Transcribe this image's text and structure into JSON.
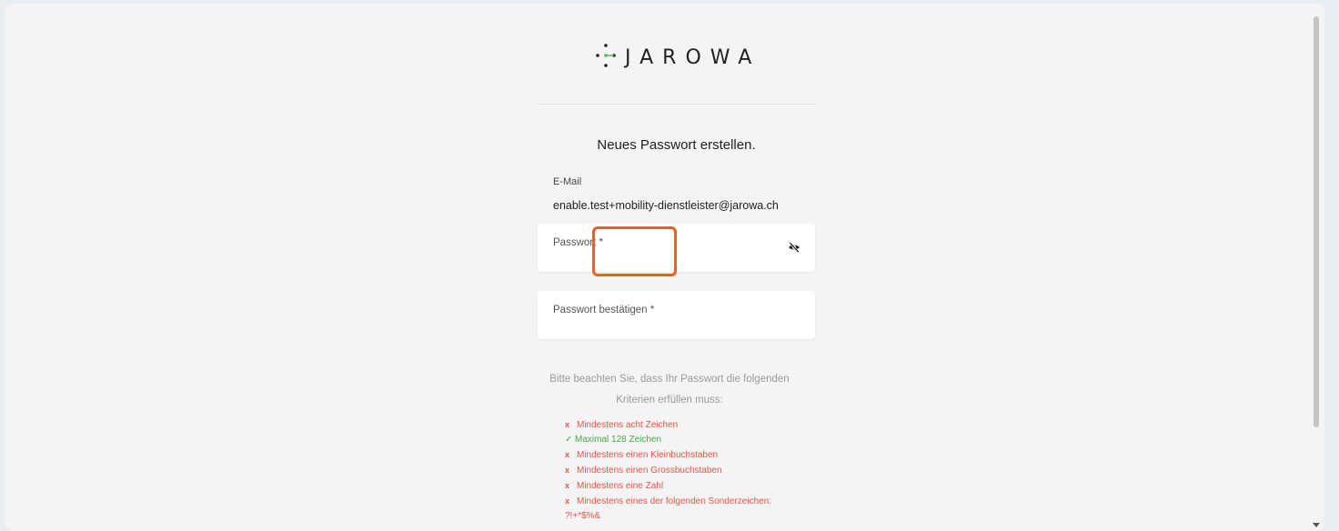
{
  "brand": {
    "name": "JAROWA",
    "dot_color": "#222222",
    "accent_color": "#5cb85c"
  },
  "title": "Neues Passwort erstellen.",
  "email": {
    "label": "E-Mail",
    "value": "enable.test+mobility-dienstleister@jarowa.ch"
  },
  "password_field": {
    "label": "Passwort *",
    "value": "",
    "icon": "eye-slash-icon"
  },
  "confirm_field": {
    "label": "Passwort bestätigen *",
    "value": ""
  },
  "criteria_intro": "Bitte beachten Sie, dass Ihr Passwort die folgenden Kriterien erfüllen muss:",
  "criteria": [
    {
      "mark": "x",
      "text": "Mindestens acht Zeichen",
      "met": false
    },
    {
      "mark": "✓",
      "text": "Maximal 128 Zeichen",
      "met": true
    },
    {
      "mark": "x",
      "text": "Mindestens einen Kleinbuchstaben",
      "met": false
    },
    {
      "mark": "x",
      "text": "Mindestens einen Grossbuchstaben",
      "met": false
    },
    {
      "mark": "x",
      "text": "Mindestens eine Zahl",
      "met": false
    },
    {
      "mark": "x",
      "text": "Mindestens eines der folgenden Sonderzeichen:",
      "met": false
    }
  ],
  "special_chars": "?!+*$%&",
  "colors": {
    "fail": "#e2554a",
    "pass": "#4aa84a",
    "highlight": "#ff5a14"
  }
}
